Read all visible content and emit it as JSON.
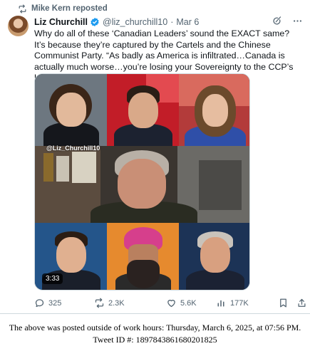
{
  "repost": {
    "label": "Mike Kern reposted",
    "icon": "repost-icon"
  },
  "author": {
    "name": "Liz Churchill",
    "handle": "@liz_churchill10",
    "separator": "·",
    "date": "Mar 6",
    "verified": true
  },
  "header_icons": [
    "grok-icon",
    "more-icon"
  ],
  "text": "Why do all of these ‘Canadian Leaders’ sound the EXACT same? It’s because they’re captured by the Cartels and the Chinese Communist Party. “As badly as America is infiltrated…Canada is actually much worse…you’re losing your Sovereignty to the CCP’s Unrestricted Warfare…”",
  "media": {
    "handle_overlay": "@Liz_Churchill10",
    "duration": "3:33"
  },
  "actions": {
    "replies": "325",
    "reposts": "2.3K",
    "likes": "5.6K",
    "views": "177K"
  },
  "footer": {
    "line1": "The above was posted outside of work hours: Thursday, March 6, 2025, at 07:56 PM.",
    "line2": "Tweet ID #: 1897843861680201825"
  },
  "colors": {
    "text": "#0f1419",
    "secondary": "#536471",
    "verified": "#1d9bf0",
    "border": "#cfd9de"
  }
}
